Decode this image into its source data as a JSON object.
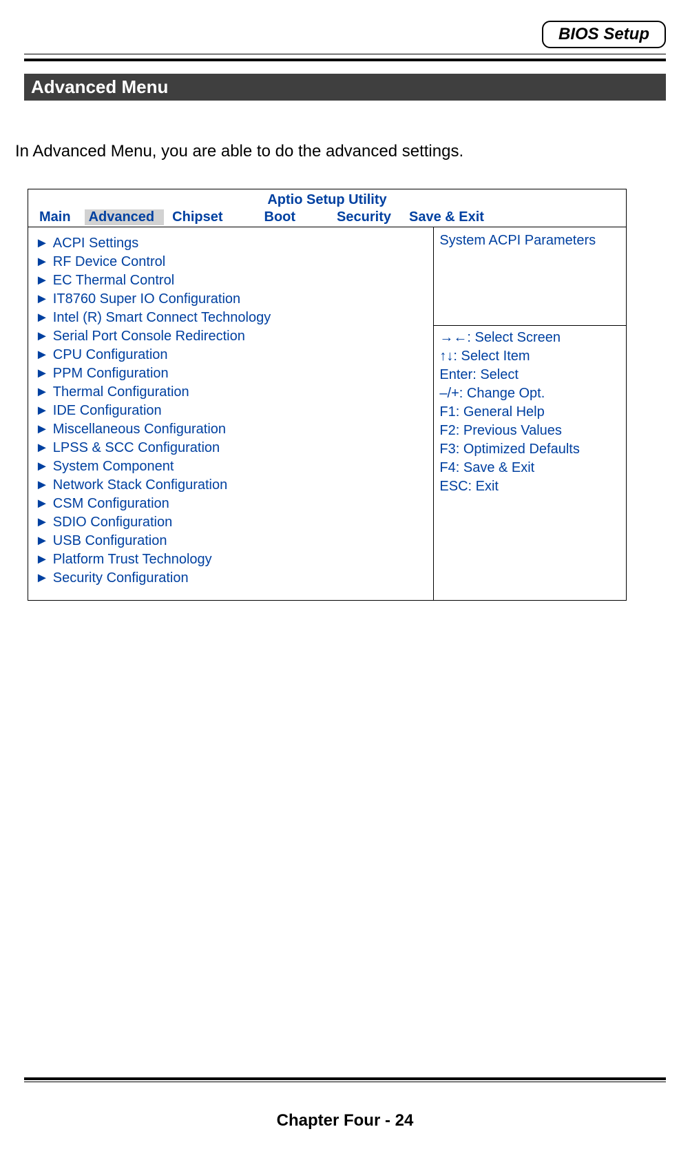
{
  "header": {
    "badge": "BIOS Setup",
    "section": " Advanced Menu"
  },
  "intro": "In Advanced Menu, you are able to do the advanced settings.",
  "bios": {
    "title": "Aptio Setup Utility",
    "tabs": {
      "main": "Main",
      "advanced": "Advanced",
      "chipset": "Chipset",
      "boot": "Boot",
      "security": "Security",
      "saveexit": "Save & Exit"
    },
    "menu_items": [
      "ACPI Settings",
      "RF Device Control",
      "EC Thermal Control",
      "IT8760 Super IO Configuration",
      "Intel (R) Smart Connect Technology",
      "Serial Port Console Redirection",
      "CPU Configuration",
      "PPM Configuration",
      "Thermal Configuration",
      "IDE Configuration",
      "Miscellaneous Configuration",
      "LPSS & SCC Configuration",
      "System Component",
      "Network Stack Configuration",
      "CSM Configuration",
      "SDIO Configuration",
      "USB Configuration",
      "Platform Trust Technology",
      "Security Configuration"
    ],
    "description": "System ACPI Parameters",
    "hints": [
      "→←: Select Screen",
      "↑↓: Select Item",
      "Enter: Select",
      "–/+: Change Opt.",
      "F1: General Help",
      "F2: Previous Values",
      "F3: Optimized Defaults",
      "F4: Save & Exit",
      "ESC: Exit"
    ]
  },
  "footer": "Chapter Four - 24"
}
